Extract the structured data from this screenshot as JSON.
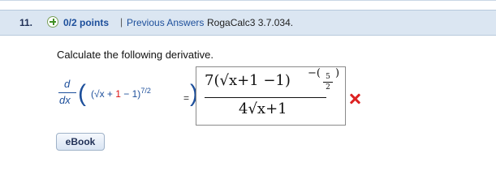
{
  "question": {
    "number": "11.",
    "points": "0/2 points",
    "separator": "|",
    "previous_answers": "Previous Answers",
    "code": "RogaCalc3 3.7.034."
  },
  "prompt": "Calculate the following derivative.",
  "problem": {
    "d_top": "d",
    "d_bottom": "dx",
    "expr_pre": "(√x + ",
    "expr_red": "1",
    "expr_post": " − 1)",
    "exponent": "7/2",
    "equals": "="
  },
  "answer": {
    "numerator": "7(√x+1 −1)",
    "exp_sign": "−(",
    "exp_top": "5",
    "exp_bottom": "2",
    "exp_close": ")",
    "denominator": "4√x+1"
  },
  "ebook_label": "eBook",
  "colors": {
    "header_bg": "#dbe6f2",
    "link_blue": "#1d4f9b",
    "wrong_red": "#d22"
  }
}
